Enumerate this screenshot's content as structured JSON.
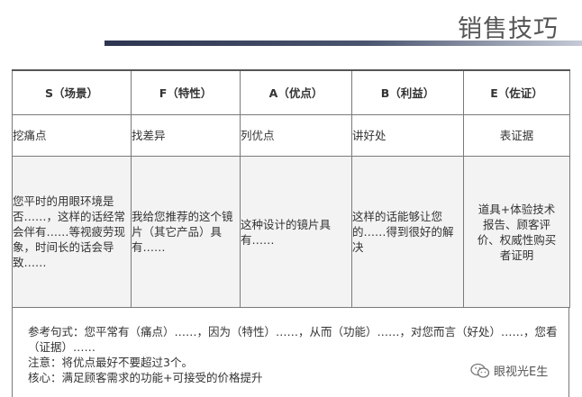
{
  "title": "销售技巧",
  "table": {
    "headers": [
      "S（场景）",
      "F（特性）",
      "A（优点）",
      "B（利益）",
      "E（佐证）"
    ],
    "subheaders": [
      "挖痛点",
      "找差异",
      "列优点",
      "讲好处",
      "表证据"
    ],
    "descriptions": [
      "您平时的用眼环境是否……，这样的话经常会伴有……等视疲劳现象，时间长的话会导致……",
      "我给您推荐的这个镜片（其它产品）具有……",
      "这种设计的镜片具有……",
      "这样的话能够让您的……得到很好的解决",
      "道具+体验技术报告、顾客评价、权威性购买者证明"
    ]
  },
  "notes": {
    "line1": "参考句式：您平常有（痛点）……，因为（特性）……，从而（功能）……，对您而言（好处）……，您看（证据）……",
    "line2": "注意：将优点最好不要超过3个。",
    "line3": "核心：满足顾客需求的功能+可接受的价格提升"
  },
  "watermark": {
    "text": "眼视光E生",
    "icon": "wechat-icon"
  }
}
